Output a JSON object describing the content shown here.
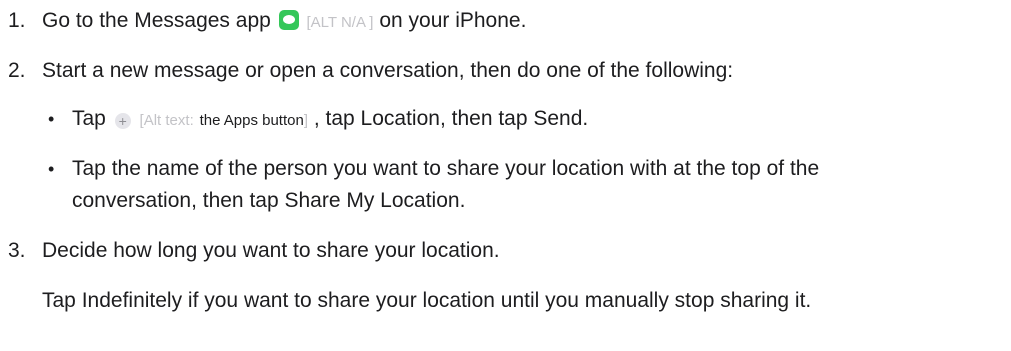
{
  "steps": [
    {
      "number": "1.",
      "before_icon": "Go to the Messages app",
      "icon": "messages-app-icon",
      "alt": "[ALT N/A ]",
      "after": "on your iPhone."
    },
    {
      "number": "2.",
      "text": "Start a new message or open a conversation, then do one of the following:"
    },
    {
      "number": "3.",
      "text": "Decide how long you want to share your location.",
      "detail": "Tap Indefinitely if you want to share your location until you manually stop sharing it."
    }
  ],
  "substeps": [
    {
      "bullet": "•",
      "before_icon": "Tap",
      "icon": "plus-icon",
      "alt_prefix": "[Alt text:",
      "alt_body": "the Apps button",
      "alt_suffix": "]",
      "after": ", tap Location, then tap Send."
    },
    {
      "bullet": "•",
      "line1": "Tap the name of the person you want to share your location with at the top of the",
      "line2": "conversation, then tap Share My Location."
    }
  ],
  "icons": {
    "messages_color": "#34c759",
    "plus_glyph": "+"
  }
}
